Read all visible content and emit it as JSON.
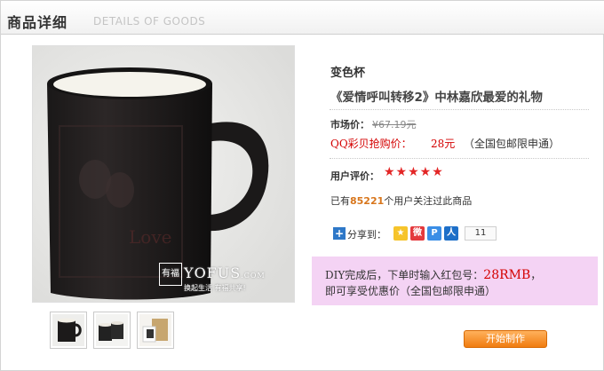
{
  "header": {
    "title": "商品详细",
    "subtitle": "DETAILS OF GOODS"
  },
  "photo": {
    "watermark_logo": "YOFUS",
    "watermark_suffix": ".COM",
    "watermark_badge": "有福",
    "watermark_slogan": "换起生活 有福共享!"
  },
  "product": {
    "name": "变色杯",
    "title": "《爱情呼叫转移2》中林嘉欣最爱的礼物",
    "market_price_label": "市场价：",
    "market_price": "¥67.19元",
    "qq_price_label": "QQ彩贝抢购价：",
    "qq_price": "28元",
    "qq_note": "（全国包邮限申通）",
    "rating_label": "用户评价：",
    "stars": "★★★★★",
    "rating_value": 5,
    "follow_prefix": "已有",
    "follow_count": "85221",
    "follow_suffix": "个用户关注过此商品"
  },
  "share": {
    "label": "分享到：",
    "icons": [
      "qzone-icon",
      "weibo-icon",
      "pengyou-icon",
      "renren-icon"
    ],
    "count": "11"
  },
  "promo": {
    "line1_prefix": "DIY完成后，下单时输入红包号：",
    "line1_code": "28RMB",
    "line1_suffix": "，",
    "line2": "即可享受优惠价（全国包邮限申通）"
  },
  "action": {
    "make_label": "开始制作"
  },
  "colors": {
    "accent_red": "#d40000",
    "button_orange": "#f07c10",
    "promo_bg": "#f4d3f4",
    "star_red": "#e32626"
  }
}
